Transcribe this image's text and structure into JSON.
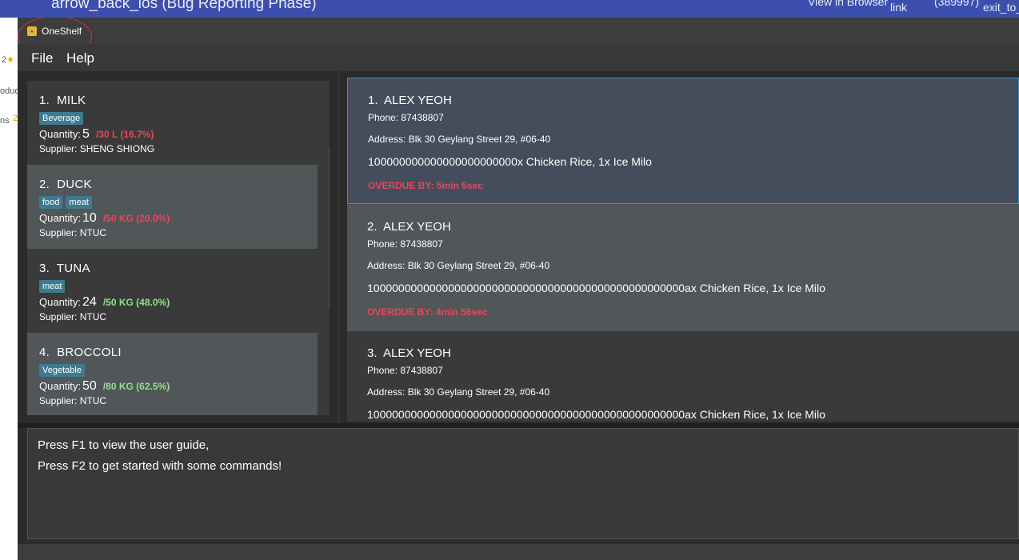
{
  "background": {
    "page_title": "arrow_back_ios (Bug Reporting Phase)",
    "view_in_browser": "View in Browser",
    "link": "link",
    "number": "(389997)",
    "exit": "exit_to_",
    "left_frags": [
      "2",
      "oduc",
      "ns",
      "2"
    ]
  },
  "window": {
    "app_title": "OneShelf",
    "menu": [
      "File",
      "Help"
    ]
  },
  "inventory": [
    {
      "index": "1.",
      "name": "MILK",
      "tags": [
        "Beverage"
      ],
      "quantity_label": "Quantity:",
      "quantity": "5",
      "capacity": "/30 L (16.7%)",
      "status": "low",
      "supplier": "Supplier: SHENG SHIONG"
    },
    {
      "index": "2.",
      "name": "DUCK",
      "tags": [
        "food",
        "meat"
      ],
      "quantity_label": "Quantity:",
      "quantity": "10",
      "capacity": "/50 KG (20.0%)",
      "status": "low",
      "supplier": "Supplier: NTUC"
    },
    {
      "index": "3.",
      "name": "TUNA",
      "tags": [
        "meat"
      ],
      "quantity_label": "Quantity:",
      "quantity": "24",
      "capacity": "/50 KG (48.0%)",
      "status": "ok",
      "supplier": "Supplier: NTUC"
    },
    {
      "index": "4.",
      "name": "BROCCOLI",
      "tags": [
        "Vegetable"
      ],
      "quantity_label": "Quantity:",
      "quantity": "50",
      "capacity": "/80 KG (62.5%)",
      "status": "ok",
      "supplier": "Supplier: NTUC"
    }
  ],
  "orders": [
    {
      "index": "1.",
      "name": "ALEX YEOH",
      "phone": "Phone: 87438807",
      "address": "Address: Blk 30 Geylang Street 29, #06-40",
      "items": "100000000000000000000000x Chicken Rice, 1x Ice Milo",
      "overdue": "OVERDUE BY: 5min 5sec"
    },
    {
      "index": "2.",
      "name": "ALEX YEOH",
      "phone": "Phone: 87438807",
      "address": "Address: Blk 30 Geylang Street 29, #06-40",
      "items": "100000000000000000000000000000000000000000000000000ax Chicken Rice, 1x Ice Milo",
      "overdue": "OVERDUE BY: 4min 56sec"
    },
    {
      "index": "3.",
      "name": "ALEX YEOH",
      "phone": "Phone: 87438807",
      "address": "Address: Blk 30 Geylang Street 29, #06-40",
      "items": "100000000000000000000000000000000000000000000000000ax Chicken Rice, 1x Ice Milo",
      "overdue": ""
    }
  ],
  "result": {
    "lines": [
      "Press F1 to view the user guide,",
      "Press F2 to get started with some commands!"
    ]
  },
  "colors": {
    "low_stock": "#e8475c",
    "ok_stock": "#8fe38a",
    "tag_bg": "#3e7b91",
    "selection_border": "#3d95c4"
  }
}
